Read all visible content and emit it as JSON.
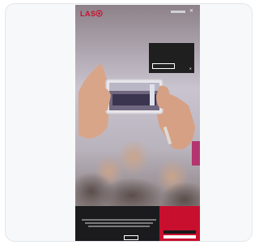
{
  "header": {
    "logo_text": "LAS",
    "brand_color": "#c8102e"
  },
  "popup": {
    "title": "",
    "text": "",
    "button_label": "",
    "close_glyph": "✕"
  },
  "hero": {
    "title": ""
  },
  "cookie": {
    "title": "",
    "text": ""
  },
  "icons": [
    "logo-mark-icon",
    "close-icon"
  ]
}
